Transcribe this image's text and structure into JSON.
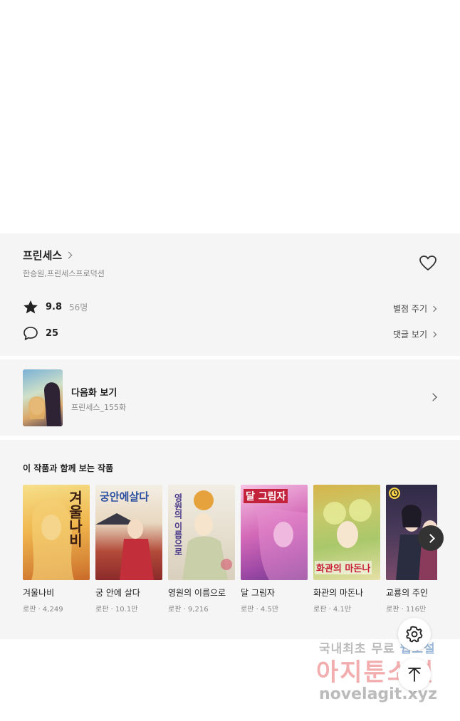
{
  "work": {
    "title": "프린세스",
    "author": "한승원,프린세스프로덕션",
    "rating": "9.8",
    "rating_count": "56명",
    "rate_action": "별점 주기",
    "comment_count": "25",
    "comment_action": "댓글 보기"
  },
  "next_episode": {
    "label": "다음화 보기",
    "subtitle": "프린세스_155화"
  },
  "recommend": {
    "heading": "이 작품과 함께 보는 작품",
    "items": [
      {
        "name": "겨울나비",
        "meta": "로판 · 4,249",
        "cover_text": "겨울나비"
      },
      {
        "name": "궁 안에 살다",
        "meta": "로판 · 10.1만",
        "cover_text": "궁안에살다"
      },
      {
        "name": "영원의 이름으로",
        "meta": "로판 · 9,216",
        "cover_text": "영원의 이름으로"
      },
      {
        "name": "달 그림자",
        "meta": "로판 · 4.5만",
        "cover_text": "달 그림자"
      },
      {
        "name": "화관의 마돈나",
        "meta": "로판 · 4.1만",
        "cover_text": "화관의 마돈나"
      },
      {
        "name": "교룡의 주인",
        "meta": "로판 · 116만",
        "cover_text": ""
      }
    ]
  },
  "watermark": {
    "line1_a": "국내최초 무료",
    "line1_b": "웹소설",
    "line2": "아지툰소설",
    "line3": "novelagit.xyz"
  },
  "icons": [
    "heart-icon",
    "star-icon",
    "comment-icon",
    "chevron-right-icon",
    "gear-icon",
    "arrow-up-icon"
  ]
}
